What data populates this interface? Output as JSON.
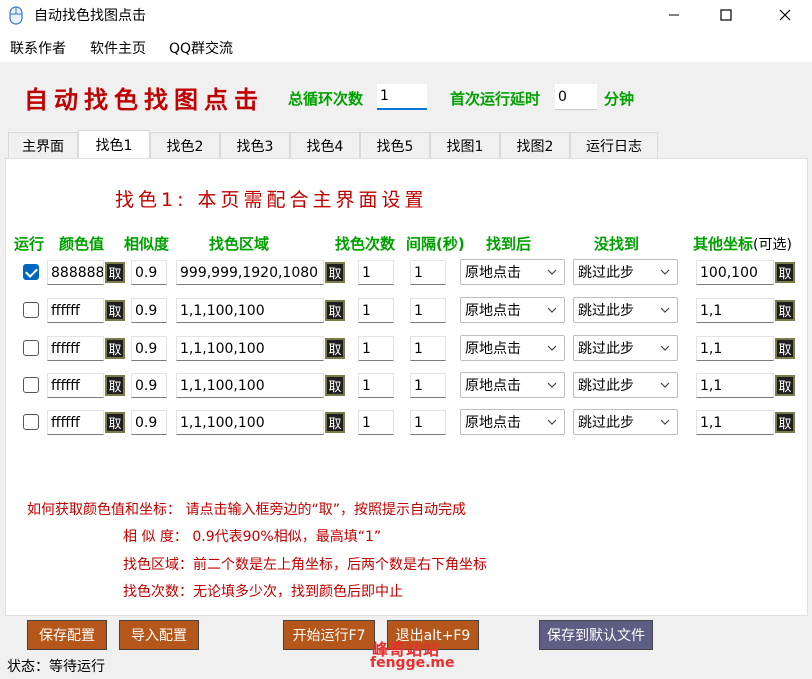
{
  "window": {
    "title": "自动找色找图点击"
  },
  "menu": {
    "items": [
      "联系作者",
      "软件主页",
      "QQ群交流"
    ]
  },
  "header": {
    "big_title": "自动找色找图点击",
    "loop_label": "总循环次数",
    "loop_value": "1",
    "delay_label": "首次运行延时",
    "delay_value": "0",
    "delay_unit": "分钟"
  },
  "tabs": [
    "主界面",
    "找色1",
    "找色2",
    "找色3",
    "找色4",
    "找色5",
    "找图1",
    "找图2",
    "运行日志"
  ],
  "active_tab": "找色1",
  "panel": {
    "title": "找色1: 本页需配合主界面设置",
    "columns": {
      "run": "运行",
      "color": "颜色值",
      "similarity": "相似度",
      "region": "找色区域",
      "times": "找色次数",
      "interval": "间隔(秒)",
      "found": "找到后",
      "notfound": "没找到",
      "other": "其他坐标",
      "other_optional": "(可选)"
    },
    "pick_label": "取",
    "rows": [
      {
        "checked": true,
        "color": "888888",
        "similarity": "0.9",
        "region": "999,999,1920,1080",
        "times": "1",
        "interval": "1",
        "found": "原地点击",
        "notfound": "跳过此步",
        "other": "100,100"
      },
      {
        "checked": false,
        "color": "ffffff",
        "similarity": "0.9",
        "region": "1,1,100,100",
        "times": "1",
        "interval": "1",
        "found": "原地点击",
        "notfound": "跳过此步",
        "other": "1,1"
      },
      {
        "checked": false,
        "color": "ffffff",
        "similarity": "0.9",
        "region": "1,1,100,100",
        "times": "1",
        "interval": "1",
        "found": "原地点击",
        "notfound": "跳过此步",
        "other": "1,1"
      },
      {
        "checked": false,
        "color": "ffffff",
        "similarity": "0.9",
        "region": "1,1,100,100",
        "times": "1",
        "interval": "1",
        "found": "原地点击",
        "notfound": "跳过此步",
        "other": "1,1"
      },
      {
        "checked": false,
        "color": "ffffff",
        "similarity": "0.9",
        "region": "1,1,100,100",
        "times": "1",
        "interval": "1",
        "found": "原地点击",
        "notfound": "跳过此步",
        "other": "1,1"
      }
    ],
    "help": [
      "如何获取颜色值和坐标：  请点击输入框旁边的“取”，按照提示自动完成",
      "相 似 度： 0.9代表90%相似，最高填“1”",
      "找色区域：前二个数是左上角坐标，后两个数是右下角坐标",
      "找色次数：无论填多少次，找到颜色后即中止"
    ]
  },
  "buttons": {
    "save_config": "保存配置",
    "import_config": "导入配置",
    "start": "开始运行F7",
    "exit": "退出alt+F9",
    "save_default": "保存到默认文件"
  },
  "status": "状态：等待运行",
  "watermark": {
    "line1": "峰哥站站",
    "line2": "fengge.me"
  },
  "colors": {
    "title_red": "#c00000",
    "label_green": "#00a000",
    "button_brown": "#b5561a",
    "button_purple": "#5e5d84",
    "accent_blue": "#0067c0"
  }
}
